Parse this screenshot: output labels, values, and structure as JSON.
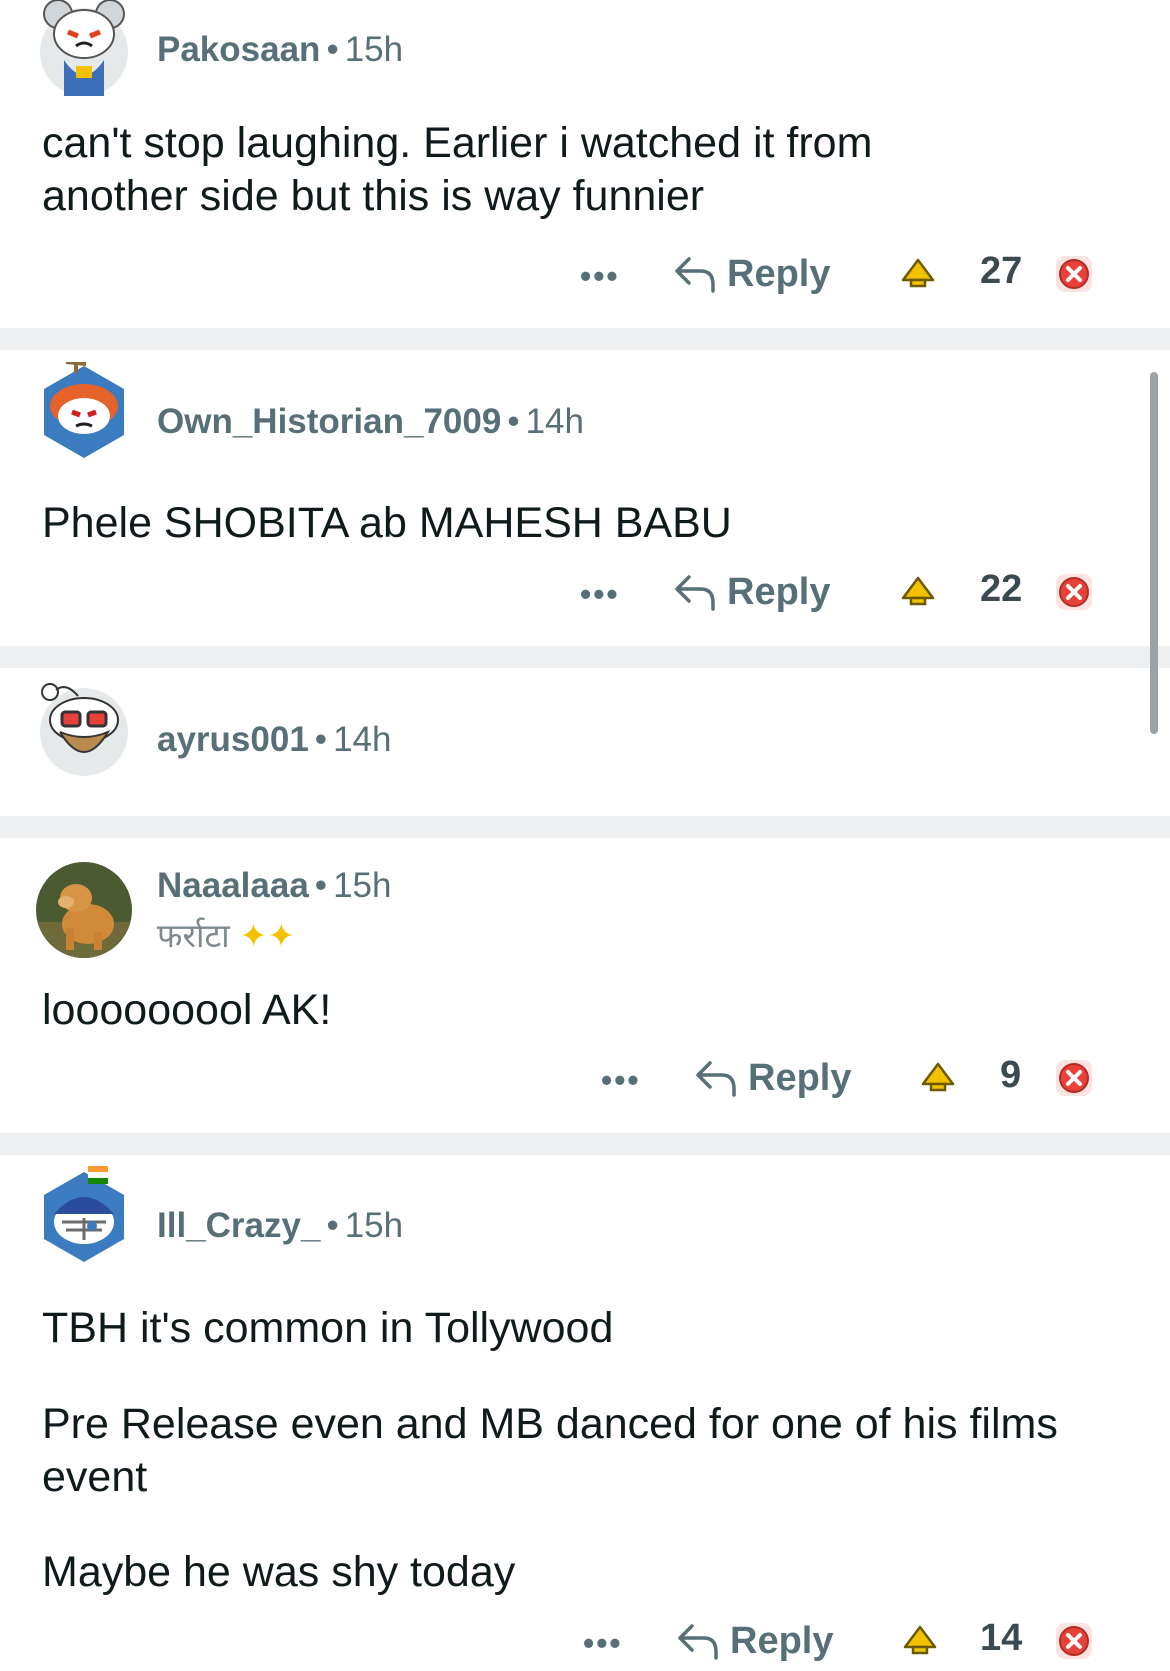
{
  "comments": [
    {
      "username": "Pakosaan",
      "time": "15h",
      "flair": "",
      "body": [
        "can't stop laughing. Earlier i  watched it from",
        "another side but this is way funnier"
      ],
      "more": "•••",
      "reply": "Reply",
      "score": "27"
    },
    {
      "username": "Own_Historian_7009",
      "time": "14h",
      "flair": "",
      "body": [
        "Phele SHOBITA ab MAHESH BABU"
      ],
      "more": "•••",
      "reply": "Reply",
      "score": "22"
    },
    {
      "username": "ayrus001",
      "time": "14h",
      "flair": "",
      "body": [],
      "more": "",
      "reply": "",
      "score": ""
    },
    {
      "username": "Naaalaaa",
      "time": "15h",
      "flair": "फर्राटा",
      "body": [
        "looooooool AK!"
      ],
      "more": "•••",
      "reply": "Reply",
      "score": "9"
    },
    {
      "username": "Ill_Crazy_",
      "time": "15h",
      "flair": "",
      "body": [
        "TBH it's common in Tollywood",
        "Pre Release even and MB danced for one of his films",
        "event",
        "Maybe he was shy today"
      ],
      "more": "•••",
      "reply": "Reply",
      "score": "14"
    }
  ],
  "separator": "•",
  "colors": {
    "text": "#0f1a1c",
    "meta": "#576f76",
    "separator": "#edeff1",
    "upvote": "#f2c200",
    "downvote": "#e8413a"
  },
  "icons": {
    "reply": "reply-arrow-icon",
    "upvote": "upvote-icon",
    "downvote": "downvote-icon",
    "more": "more-options-icon"
  }
}
